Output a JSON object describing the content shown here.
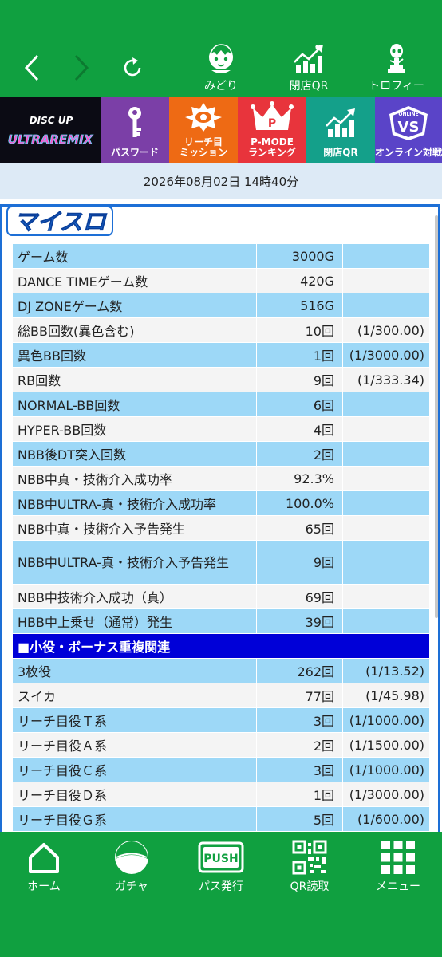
{
  "top_nav": {
    "back_icon": "chevron-left-icon",
    "forward_icon": "chevron-right-icon",
    "refresh_icon": "refresh-icon",
    "items": [
      {
        "label": "みどり",
        "icon": "character-icon"
      },
      {
        "label": "閉店QR",
        "icon": "growth-chart-icon"
      },
      {
        "label": "トロフィー",
        "icon": "trophy-alien-icon"
      }
    ]
  },
  "tiles": {
    "logo": {
      "line1": "DISC UP",
      "line2": "ULTRAREMIX"
    },
    "items": [
      {
        "label_line1": "パスワード",
        "label_line2": "",
        "icon": "key-icon"
      },
      {
        "label_line1": "リーチ目",
        "label_line2": "ミッション",
        "icon": "mission-badge-icon"
      },
      {
        "label_line1": "P-MODE",
        "label_line2": "ランキング",
        "icon": "crown-icon"
      },
      {
        "label_line1": "閉店QR",
        "label_line2": "",
        "icon": "growth-chart-icon"
      },
      {
        "label_line1": "オンライン対戦",
        "label_line2": "",
        "icon": "versus-icon"
      }
    ],
    "vs_badge": "ONLINE",
    "vs_text": "VS",
    "pmode_letter": "P"
  },
  "date_text": "2026年08月02日 14時40分",
  "myslo_logo": "マイスロ",
  "stats": [
    {
      "label": "ゲーム数",
      "value": "3000G",
      "ratio": ""
    },
    {
      "label": "DANCE TIMEゲーム数",
      "value": "420G",
      "ratio": ""
    },
    {
      "label": "DJ ZONEゲーム数",
      "value": "516G",
      "ratio": ""
    },
    {
      "label": "総BB回数(異色含む)",
      "value": "10回",
      "ratio": "(1/300.00)"
    },
    {
      "label": "異色BB回数",
      "value": "1回",
      "ratio": "(1/3000.00)"
    },
    {
      "label": "RB回数",
      "value": "9回",
      "ratio": "(1/333.34)"
    },
    {
      "label": "NORMAL-BB回数",
      "value": "6回",
      "ratio": ""
    },
    {
      "label": "HYPER-BB回数",
      "value": "4回",
      "ratio": ""
    },
    {
      "label": "NBB後DT突入回数",
      "value": "2回",
      "ratio": ""
    },
    {
      "label": "NBB中真・技術介入成功率",
      "value": "92.3%",
      "ratio": ""
    },
    {
      "label": "NBB中ULTRA-真・技術介入成功率",
      "value": "100.0%",
      "ratio": ""
    },
    {
      "label": "NBB中真・技術介入予告発生",
      "value": "65回",
      "ratio": ""
    },
    {
      "label": "NBB中ULTRA-真・技術介入予告発生",
      "value": "9回",
      "ratio": ""
    },
    {
      "label": "NBB中技術介入成功（真）",
      "value": "69回",
      "ratio": ""
    },
    {
      "label": "HBB中上乗せ（通常）発生",
      "value": "39回",
      "ratio": ""
    }
  ],
  "section_title": "■小役・ボーナス重複関連",
  "koyaku": [
    {
      "label": "3枚役",
      "value": "262回",
      "ratio": "(1/13.52)"
    },
    {
      "label": "スイカ",
      "value": "77回",
      "ratio": "(1/45.98)"
    },
    {
      "label": "リーチ目役Ｔ系",
      "value": "3回",
      "ratio": "(1/1000.00)"
    },
    {
      "label": "リーチ目役Ａ系",
      "value": "2回",
      "ratio": "(1/1500.00)"
    },
    {
      "label": "リーチ目役Ｃ系",
      "value": "3回",
      "ratio": "(1/1000.00)"
    },
    {
      "label": "リーチ目役Ｄ系",
      "value": "1回",
      "ratio": "(1/3000.00)"
    },
    {
      "label": "リーチ目役Ｇ系",
      "value": "5回",
      "ratio": "(1/600.00)"
    }
  ],
  "bottom_nav": [
    {
      "label": "ホーム",
      "icon": "home-icon"
    },
    {
      "label": "ガチャ",
      "icon": "gacha-ball-icon"
    },
    {
      "label": "パス発行",
      "icon": "push-icon"
    },
    {
      "label": "QR読取",
      "icon": "qr-code-icon"
    },
    {
      "label": "メニュー",
      "icon": "grid-menu-icon"
    }
  ],
  "push_text": "PUSH",
  "colors": {
    "nav_green": "#10a040",
    "table_blue": "#9dd8f7",
    "section_blue": "#0000d8",
    "frame_blue": "#1d6fd6"
  }
}
